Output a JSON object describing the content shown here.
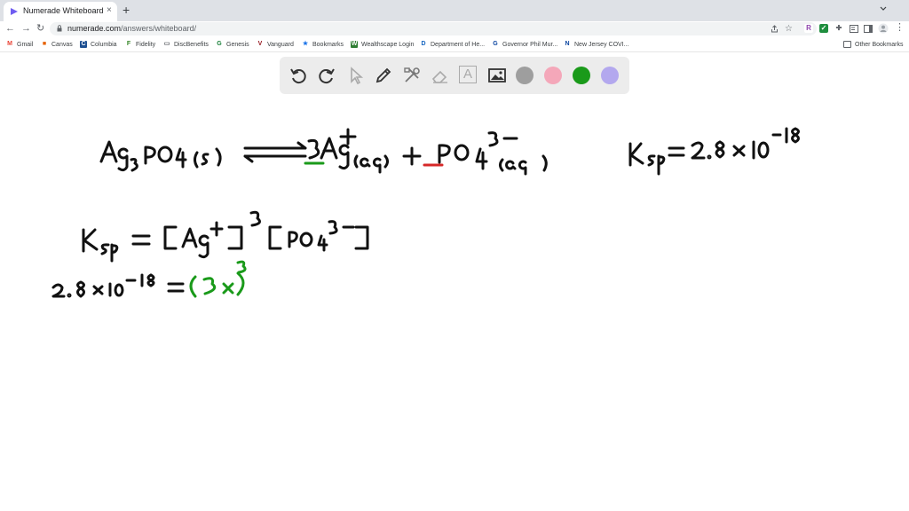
{
  "browser": {
    "tab": {
      "title": "Numerade Whiteboard",
      "close": "×"
    },
    "new_tab": "+",
    "url": {
      "host": "numerade.com",
      "path": "/answers/whiteboard/"
    },
    "window_controls": [
      "minimize-icon",
      "maximize-icon",
      "close-icon"
    ]
  },
  "nav": {
    "back": "←",
    "forward": "→",
    "reload": "↻"
  },
  "extensions": [
    {
      "name": "r-extension-icon",
      "glyph": "R",
      "color": "#8e44ad"
    },
    {
      "name": "green-extension-icon",
      "glyph": "✓",
      "color": "#1e8e3e"
    },
    {
      "name": "puzzle-extension-icon",
      "glyph": "✚",
      "color": "#5f6368"
    }
  ],
  "bookmarks": [
    {
      "label": "Gmail",
      "icon": "M",
      "color": "#ea4335"
    },
    {
      "label": "Canvas",
      "icon": "■",
      "color": "#e66000"
    },
    {
      "label": "Columbia",
      "icon": "C",
      "color": "#1d4f91"
    },
    {
      "label": "Fidelity",
      "icon": "F",
      "color": "#368727"
    },
    {
      "label": "DiscBenefits",
      "icon": "▭",
      "color": "#5f6368"
    },
    {
      "label": "Genesis",
      "icon": "G",
      "color": "#188038"
    },
    {
      "label": "Vanguard",
      "icon": "V",
      "color": "#96151d"
    },
    {
      "label": "Bookmarks",
      "icon": "★",
      "color": "#1a73e8"
    },
    {
      "label": "Wealthscape Login",
      "icon": "W",
      "color": "#2e7d32"
    },
    {
      "label": "Department of He...",
      "icon": "D",
      "color": "#1565c0"
    },
    {
      "label": "Governor Phil Mur...",
      "icon": "G",
      "color": "#0d47a1"
    },
    {
      "label": "New Jersey COVI...",
      "icon": "N",
      "color": "#0d47a1"
    }
  ],
  "other_bookmarks": "Other Bookmarks",
  "whiteboard": {
    "tools": [
      "undo-icon",
      "redo-icon",
      "select-arrow-icon",
      "pen-icon",
      "tools-icon",
      "eraser-icon",
      "text-icon",
      "image-icon"
    ],
    "colors": [
      "#9e9e9e",
      "#f4a7b9",
      "#1a9a1a",
      "#b3a8ee"
    ],
    "text_tool_label": "A"
  },
  "ink_colors": {
    "black": "#111111",
    "green": "#1a9a1a",
    "red": "#d62828"
  }
}
